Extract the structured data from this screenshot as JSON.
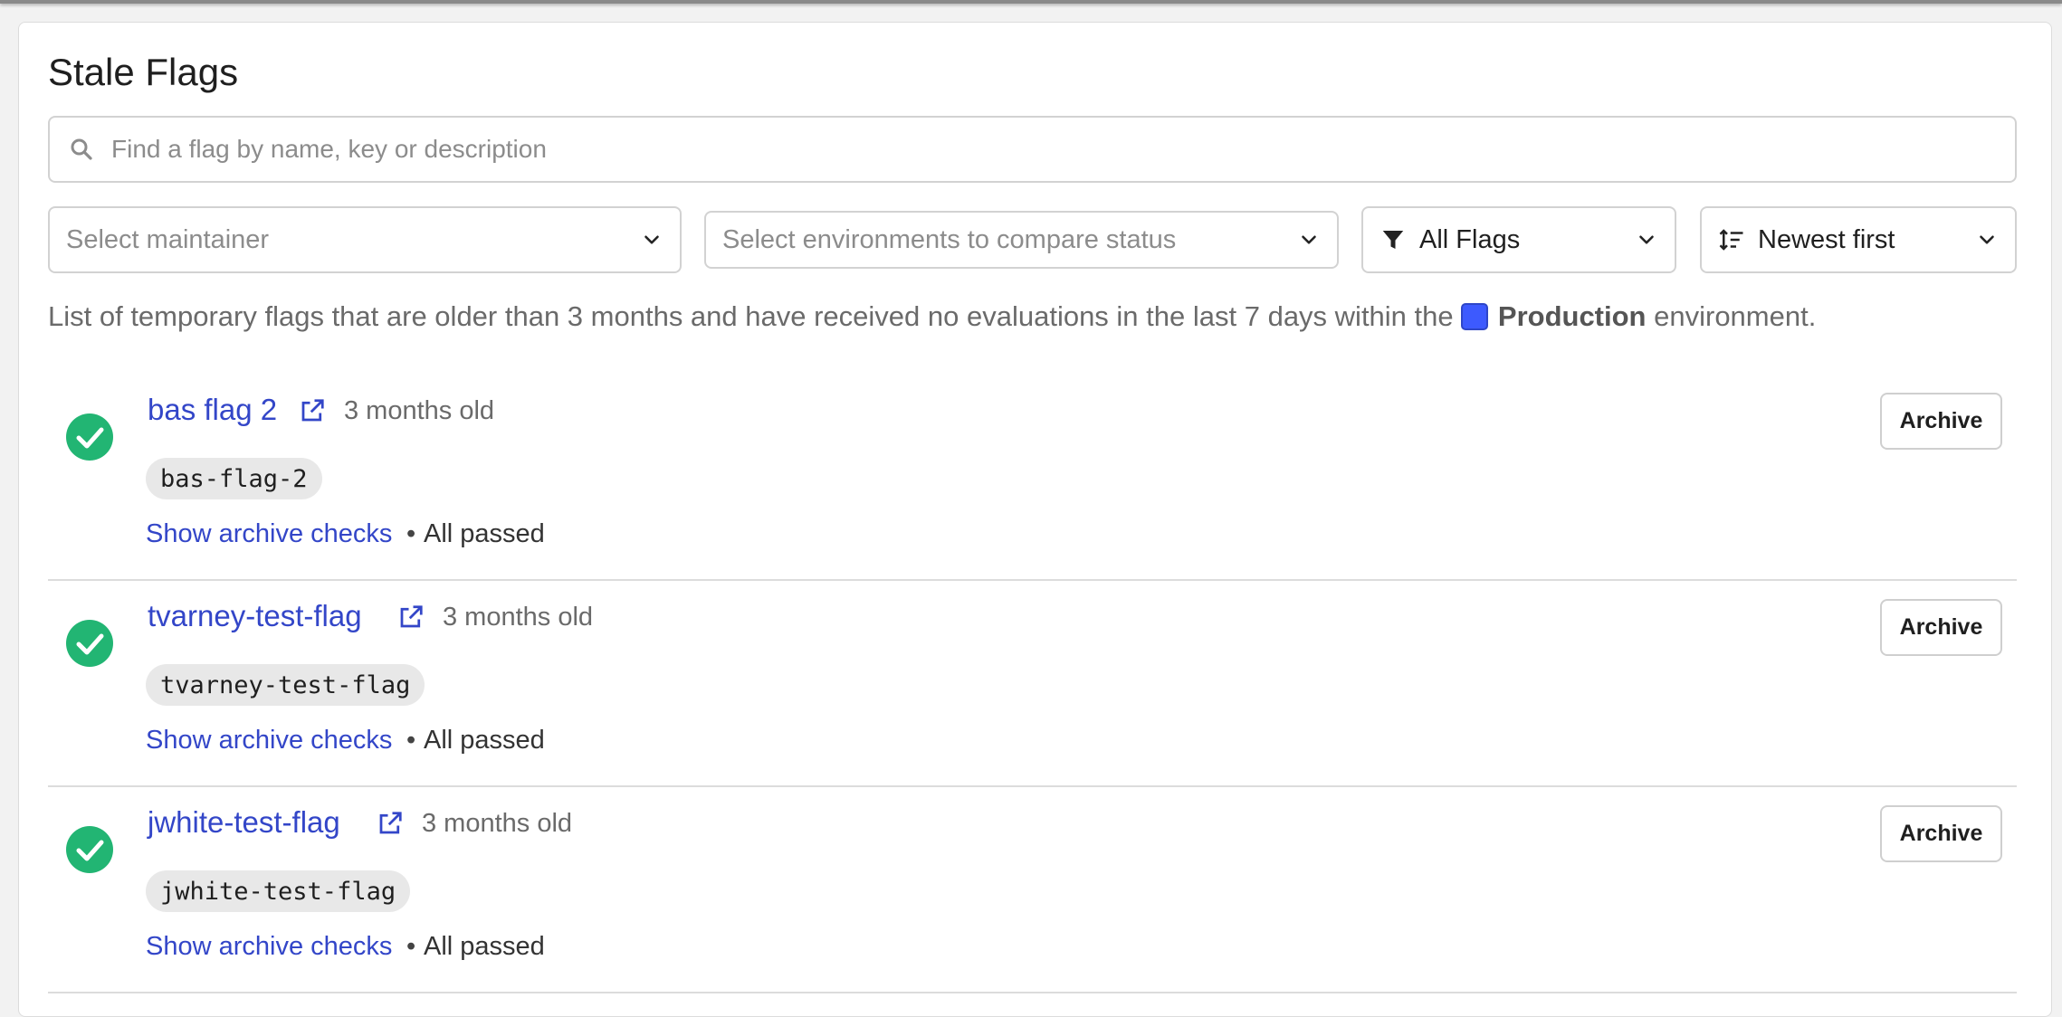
{
  "page": {
    "title": "Stale Flags"
  },
  "search": {
    "placeholder": "Find a flag by name, key or description",
    "value": ""
  },
  "filters": {
    "maintainer_placeholder": "Select maintainer",
    "environments_placeholder": "Select environments to compare status",
    "flag_filter_value": "All Flags",
    "sort_value": "Newest first"
  },
  "description": {
    "prefix": "List of temporary flags that are older than 3 months and have received no evaluations in the last 7 days within the",
    "environment": "Production",
    "suffix": "environment.",
    "environment_color": "#3d5afe"
  },
  "flags": [
    {
      "name": "bas flag 2",
      "age": "3 months old",
      "key": "bas-flag-2",
      "checks_link": "Show archive checks",
      "separator": "•",
      "status": "All passed",
      "archive_label": "Archive"
    },
    {
      "name": "tvarney-test-flag",
      "age": "3 months old",
      "key": "tvarney-test-flag",
      "checks_link": "Show archive checks",
      "separator": "•",
      "status": "All passed",
      "archive_label": "Archive"
    },
    {
      "name": "jwhite-test-flag",
      "age": "3 months old",
      "key": "jwhite-test-flag",
      "checks_link": "Show archive checks",
      "separator": "•",
      "status": "All passed",
      "archive_label": "Archive"
    }
  ],
  "colors": {
    "link": "#3346c8",
    "success": "#22b573"
  }
}
